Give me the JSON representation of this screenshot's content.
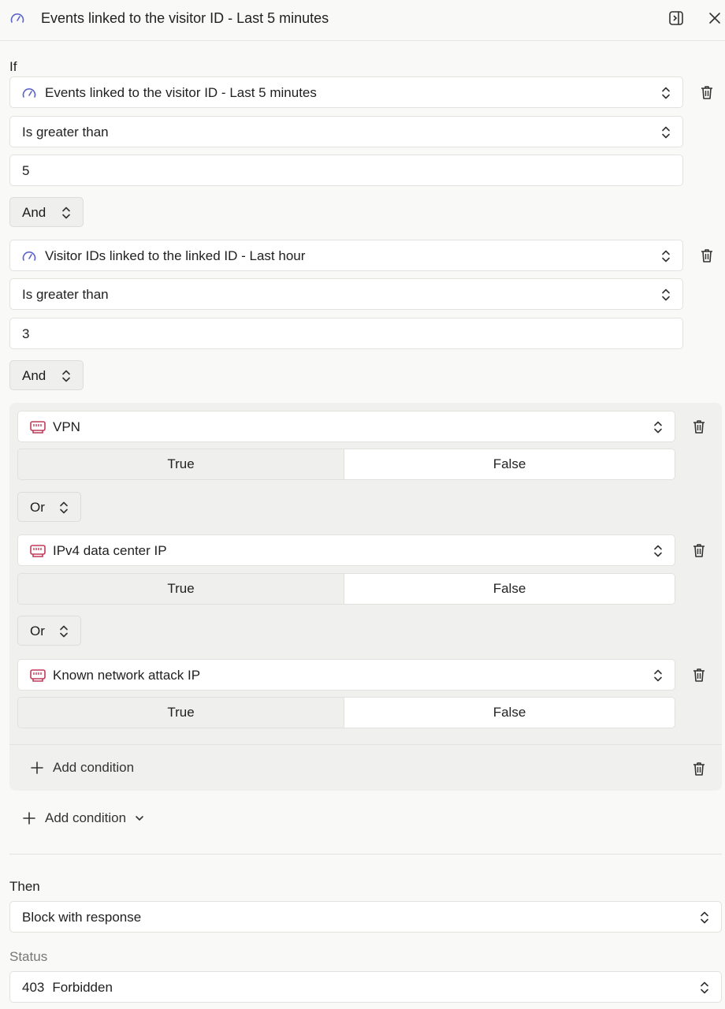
{
  "header": {
    "title": "Events linked to the visitor ID - Last 5 minutes",
    "icons": {
      "lead": "gauge-icon",
      "sidebar": "sidebar-toggle-icon",
      "close": "close-icon"
    }
  },
  "if_section": {
    "label": "If",
    "conditions": [
      {
        "signal": "Events linked to the visitor ID - Last 5 minutes",
        "operator": "Is greater than",
        "value": "5",
        "icon": "gauge-icon"
      },
      {
        "signal": "Visitor IDs linked to the linked ID - Last hour",
        "operator": "Is greater than",
        "value": "3",
        "icon": "gauge-icon"
      }
    ],
    "connectors": [
      "And",
      "And"
    ],
    "group": {
      "items": [
        {
          "signal": "VPN",
          "true_label": "True",
          "false_label": "False",
          "selected": "False",
          "icon": "network-icon"
        },
        {
          "signal": "IPv4 data center IP",
          "true_label": "True",
          "false_label": "False",
          "selected": "False",
          "icon": "network-icon"
        },
        {
          "signal": "Known network attack IP",
          "true_label": "True",
          "false_label": "False",
          "selected": "False",
          "icon": "network-icon"
        }
      ],
      "connectors": [
        "Or",
        "Or"
      ],
      "add_condition": "Add condition"
    },
    "add_condition": "Add condition"
  },
  "then_section": {
    "label": "Then",
    "action": "Block with response",
    "status_label": "Status",
    "status_code": "403",
    "status_text": "Forbidden"
  },
  "colors": {
    "accent_gauge": "#5b63c9",
    "network_icon": "#c23a5a"
  }
}
